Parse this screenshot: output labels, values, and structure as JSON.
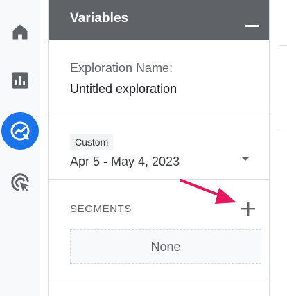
{
  "nav_rail": {
    "items": [
      {
        "name": "Home",
        "icon": "home-icon"
      },
      {
        "name": "Reports",
        "icon": "reports-icon"
      },
      {
        "name": "Explore",
        "icon": "explore-icon",
        "active": true
      },
      {
        "name": "Advertising",
        "icon": "advertising-icon"
      }
    ],
    "active_color": "#1a73e8"
  },
  "variables_panel": {
    "title": "Variables",
    "header_color": "#5f6368",
    "exploration_name": {
      "label": "Exploration Name:",
      "value": "Untitled exploration"
    },
    "date_range": {
      "chip": "Custom",
      "value": "Apr 5 - May 4, 2023"
    },
    "segments": {
      "label": "SEGMENTS",
      "empty_value": "None"
    }
  },
  "annotation": {
    "type": "arrow",
    "color": "#e8175d"
  }
}
